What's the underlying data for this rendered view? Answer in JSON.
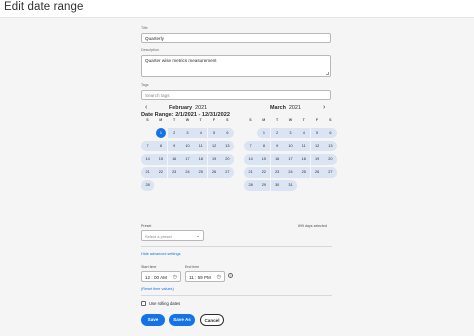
{
  "page": {
    "title": "Edit date range"
  },
  "form": {
    "title_label": "Title",
    "title_value": "Quarterly",
    "description_label": "Description",
    "description_value": "Quarter wise metrics measurement",
    "tags_label": "Tags",
    "tags_placeholder": "Search tags"
  },
  "date_range": {
    "heading": "Date Range: 2/1/2021 - 12/31/2022",
    "prev_icon": "chevron-left-icon",
    "next_icon": "chevron-right-icon",
    "weekdays": [
      "S",
      "M",
      "T",
      "W",
      "T",
      "F",
      "S"
    ],
    "months": [
      {
        "name": "February",
        "year": "2021",
        "first_weekday": 1,
        "days": 28,
        "selected_start": 1
      },
      {
        "name": "March",
        "year": "2021",
        "first_weekday": 1,
        "days": 31
      }
    ],
    "days_selected": "699 days selected"
  },
  "preset": {
    "label": "Preset",
    "placeholder": "Select a preset",
    "icon": "chevron-down-icon"
  },
  "advanced": {
    "hide_link": "Hide advanced settings",
    "start_label": "Start time",
    "start_value": "12 : 00  AM",
    "end_label": "End time",
    "end_value": "11 : 59  PM",
    "reset_link": "Reset time values",
    "clock_icon": "clock-icon",
    "info_icon": "info-icon"
  },
  "rolling": {
    "label": "Use rolling dates",
    "checked": false
  },
  "buttons": {
    "save": "Save",
    "save_as": "Save As",
    "cancel": "Cancel"
  },
  "colors": {
    "accent": "#1473e6",
    "range_fill": "#dbe4f3"
  }
}
